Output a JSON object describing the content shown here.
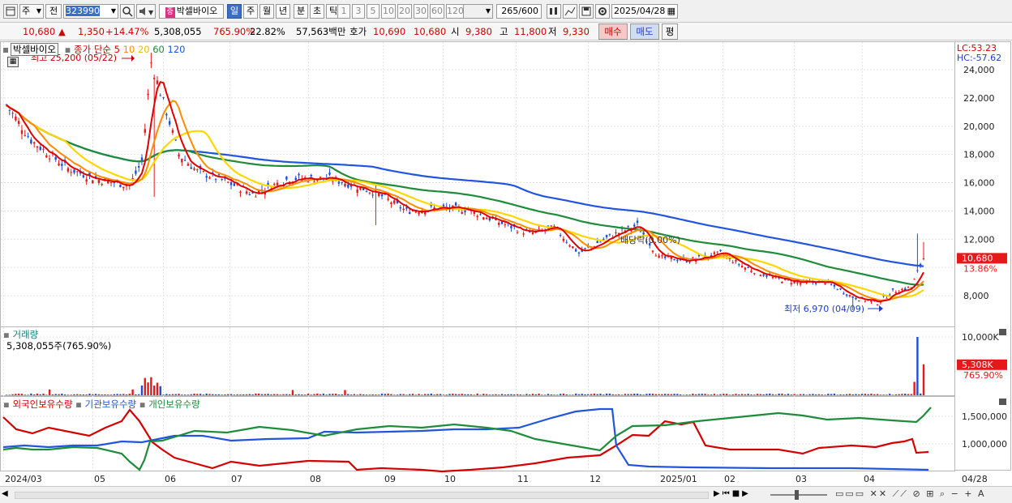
{
  "toolbar": {
    "period_type": "주",
    "prev_label": "전",
    "code": "323990",
    "stock_name": "박셀바이오",
    "stock_badge": "중",
    "periods": [
      "일",
      "주",
      "월",
      "년",
      "분",
      "초",
      "틱"
    ],
    "active_period": "일",
    "intervals": [
      "1",
      "3",
      "5",
      "10",
      "20",
      "30",
      "60",
      "120"
    ],
    "count_value": "265",
    "count_max": "/600",
    "date": "2025/04/28"
  },
  "quote": {
    "price": "10,680",
    "change": "1,350",
    "change_pct": "+14.47%",
    "volume": "5,308,055",
    "volume_pct": "765.90%",
    "turnover": "22.82%",
    "amount": "57,563백만",
    "bid_label": "호가",
    "bid_price": "10,690",
    "ask_price": "10,680",
    "open_label": "시",
    "open": "9,380",
    "high_label": "고",
    "high": "11,800",
    "low_label": "저",
    "low": "9,330",
    "buy_label": "매수",
    "sell_label": "매도",
    "avg_label": "평"
  },
  "price_pane": {
    "title": "박셀바이오",
    "ma_label": "종가 단순",
    "ma_periods": [
      "5",
      "10",
      "20",
      "60",
      "120"
    ],
    "ma_colors": [
      "#e00000",
      "#ff8c00",
      "#ffd700",
      "#1e8c3a",
      "#2255dd"
    ],
    "lc": "LC:53.23",
    "hc": "HC:-57.62",
    "max_note": "최고 25,200 (05/22)",
    "min_note": "최저 6,970 (04/09)",
    "dividend_note": "배당락(0.00%)",
    "current_price": "10,680",
    "current_pct": "13.86%",
    "y_labels": [
      "24,000",
      "22,000",
      "20,000",
      "18,000",
      "16,000",
      "14,000",
      "12,000",
      "8,000"
    ]
  },
  "volume_pane": {
    "title": "거래량",
    "value": "5,308,055주(765.90%)",
    "y_labels": [
      "10,000K"
    ],
    "current": "5,308K",
    "current_pct": "765.90%"
  },
  "holdings_pane": {
    "series": [
      "외국인보유수량",
      "기관보유수량",
      "개인보유수량"
    ],
    "colors": [
      "#d40000",
      "#2255dd",
      "#1e8c3a"
    ],
    "y_labels": [
      "1,500,000",
      "1,000,000"
    ]
  },
  "x_axis": [
    "2024/03",
    "05",
    "06",
    "07",
    "08",
    "09",
    "10",
    "11",
    "12",
    "2025/01",
    "02",
    "03",
    "04"
  ],
  "x_end_label": "04/28"
}
